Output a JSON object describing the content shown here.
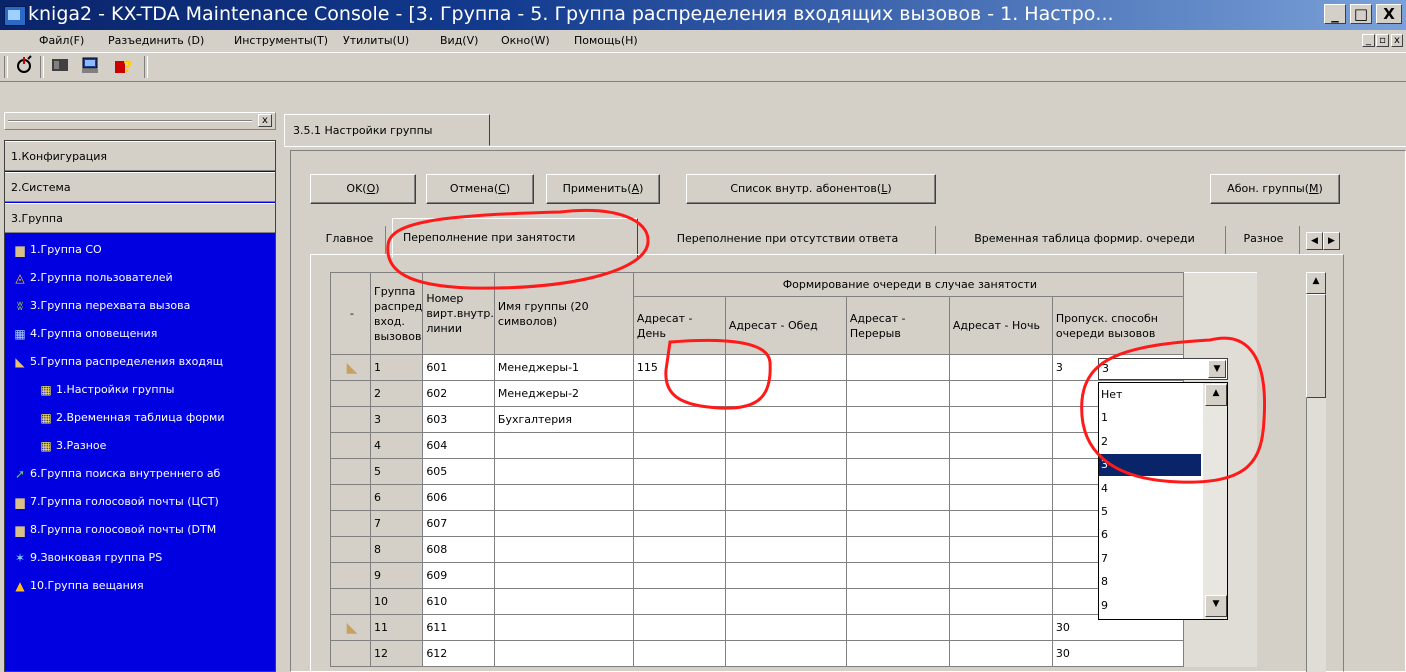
{
  "window": {
    "title": "kniga2 - KX-TDA Maintenance Console - [3. Группа - 5. Группа распределения входящих вызовов - 1. Настро...",
    "minimize": "_",
    "maximize": "□",
    "close": "X"
  },
  "menu": {
    "items": [
      "Файл(F)",
      "Разъединить (D)",
      "Инструменты(T)",
      "Утилиты(U)",
      "Вид(V)",
      "Окно(W)",
      "Помощь(H)"
    ],
    "mdi_minimize": "_",
    "mdi_restore": "▫",
    "mdi_close": "x"
  },
  "toolbar": {
    "icons": [
      "connect-icon",
      "device-icon",
      "terminal-icon",
      "help-icon"
    ]
  },
  "tree": {
    "close": "x",
    "categories": [
      "1.Конфигурация",
      "2.Система",
      "3.Группа"
    ],
    "items": [
      {
        "label": "1.Группа CO",
        "icon": "folder-icon",
        "level": 0
      },
      {
        "label": "2.Группа пользователей",
        "icon": "users-icon",
        "level": 0
      },
      {
        "label": "3.Группа перехвата вызова",
        "icon": "pickup-icon",
        "level": 0
      },
      {
        "label": "4.Группа оповещения",
        "icon": "paging-icon",
        "level": 0
      },
      {
        "label": "5.Группа распределения входящ",
        "icon": "open-folder-icon",
        "level": 0
      },
      {
        "label": "1.Настройки группы",
        "icon": "grid-icon",
        "level": 1
      },
      {
        "label": "2.Временная таблица форми",
        "icon": "grid-icon",
        "level": 1
      },
      {
        "label": "3.Разное",
        "icon": "grid-icon",
        "level": 1
      },
      {
        "label": "6.Группа поиска внутреннего аб",
        "icon": "hunt-icon",
        "level": 0
      },
      {
        "label": "7.Группа голосовой почты (ЦСТ)",
        "icon": "folder-icon",
        "level": 0
      },
      {
        "label": "8.Группа голосовой почты (DTM",
        "icon": "folder-icon",
        "level": 0
      },
      {
        "label": "9.Звонковая группа PS",
        "icon": "ps-icon",
        "level": 0
      },
      {
        "label": "10.Группа вещания",
        "icon": "broadcast-icon",
        "level": 0
      }
    ]
  },
  "doc_tab": "3.5.1 Настройки группы",
  "buttons": {
    "ok": {
      "pre": "OK(",
      "key": "O",
      "post": ")"
    },
    "cancel": {
      "pre": "Отмена(",
      "key": "C",
      "post": ")"
    },
    "apply": {
      "pre": "Применить(",
      "key": "A",
      "post": ")"
    },
    "ext_list": {
      "pre": "Список внутр. абонентов(",
      "key": "L",
      "post": ")"
    },
    "members": {
      "pre": "Абон. группы(",
      "key": "M",
      "post": ")"
    }
  },
  "tabs": [
    "Главное",
    "Переполнение при занятости",
    "Переполнение при отсутствии ответа",
    "Временная таблица формир. очереди",
    "Разное"
  ],
  "grid": {
    "group_header": "Формирование очереди в случае занятости",
    "headers": {
      "rowhead": "-",
      "group": "Группа распред вход. вызовов",
      "number": "Номер вирт.внутр. линии",
      "name": "Имя группы (20 символов)",
      "day": "Адресат - День",
      "lunch": "Адресат - Обед",
      "break": "Адресат - Перерыв",
      "night": "Адресат - Ночь",
      "skip": "Пропуск. способн очереди вызовов"
    },
    "rows": [
      {
        "n": "1",
        "num": "601",
        "name": "Менеджеры-1",
        "day": "115",
        "skip": "3",
        "icon": true
      },
      {
        "n": "2",
        "num": "602",
        "name": "Менеджеры-2",
        "day": "",
        "skip": ""
      },
      {
        "n": "3",
        "num": "603",
        "name": "Бухгалтерия",
        "day": "",
        "skip": ""
      },
      {
        "n": "4",
        "num": "604",
        "name": "",
        "day": "",
        "skip": ""
      },
      {
        "n": "5",
        "num": "605",
        "name": "",
        "day": "",
        "skip": ""
      },
      {
        "n": "6",
        "num": "606",
        "name": "",
        "day": "",
        "skip": ""
      },
      {
        "n": "7",
        "num": "607",
        "name": "",
        "day": "",
        "skip": ""
      },
      {
        "n": "8",
        "num": "608",
        "name": "",
        "day": "",
        "skip": ""
      },
      {
        "n": "9",
        "num": "609",
        "name": "",
        "day": "",
        "skip": ""
      },
      {
        "n": "10",
        "num": "610",
        "name": "",
        "day": "",
        "skip": ""
      },
      {
        "n": "11",
        "num": "611",
        "name": "",
        "day": "",
        "skip": "30",
        "icon": true
      },
      {
        "n": "12",
        "num": "612",
        "name": "",
        "day": "",
        "skip": "30"
      }
    ]
  },
  "dropdown": {
    "value": "3",
    "options": [
      "Нет",
      "1",
      "2",
      "3",
      "4",
      "5",
      "6",
      "7",
      "8",
      "9"
    ],
    "selected_index": 3
  },
  "colors": {
    "tree_background": "#0000e0",
    "selection": "#0a246a",
    "annotation": "#ff1a1a"
  }
}
